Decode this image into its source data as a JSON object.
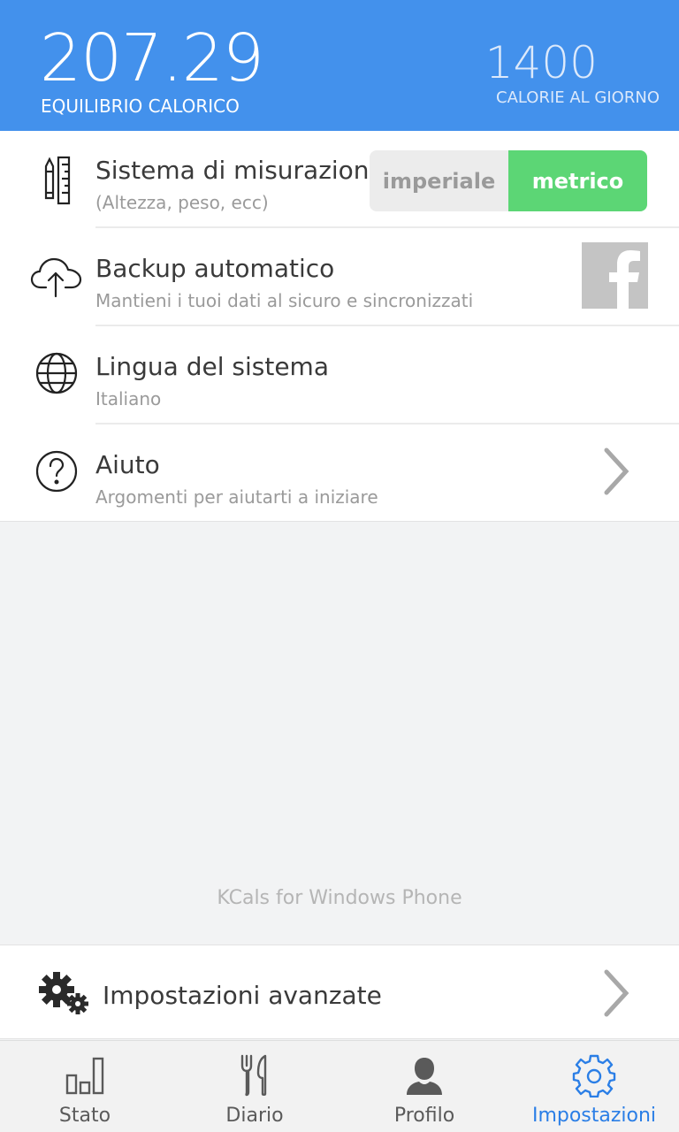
{
  "header": {
    "balance_value": "207.29",
    "balance_label": "EQUILIBRIO CALORICO",
    "daily_value": "1400",
    "daily_label": "CALORIE AL GIORNO"
  },
  "settings": {
    "measurement": {
      "title": "Sistema di misurazione",
      "subtitle": "(Altezza, peso, ecc)",
      "options": [
        "imperiale",
        "metrico"
      ],
      "selected": "metrico"
    },
    "backup": {
      "title": "Backup automatico",
      "subtitle": "Mantieni i tuoi dati al sicuro e sincronizzati"
    },
    "language": {
      "title": "Lingua del sistema",
      "subtitle": "Italiano"
    },
    "help": {
      "title": "Aiuto",
      "subtitle": "Argomenti per aiutarti a iniziare"
    }
  },
  "footer_text": "KCals for Windows Phone",
  "advanced": {
    "title": "Impostazioni avanzate"
  },
  "tabs": [
    {
      "label": "Stato",
      "icon": "bar-chart-icon"
    },
    {
      "label": "Diario",
      "icon": "fork-knife-icon"
    },
    {
      "label": "Profilo",
      "icon": "person-icon"
    },
    {
      "label": "Impostazioni",
      "icon": "gear-icon",
      "active": true
    }
  ],
  "colors": {
    "header": "#4391ec",
    "toggle_on": "#5cd675",
    "tab_active": "#2a7ee6"
  }
}
